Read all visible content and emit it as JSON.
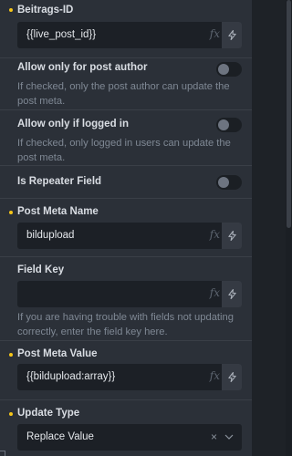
{
  "beitrags_id": {
    "label": "Beitrags-ID",
    "value": "{{live_post_id}}",
    "fx": "fx"
  },
  "allow_post_author": {
    "label": "Allow only for post author",
    "description": "If checked, only the post author can update the post meta.",
    "checked": false
  },
  "allow_logged_in": {
    "label": "Allow only if logged in",
    "description": "If checked, only logged in users can update the post meta.",
    "checked": false
  },
  "repeater_field": {
    "label": "Is Repeater Field",
    "checked": false
  },
  "post_meta_name": {
    "label": "Post Meta Name",
    "value": "bildupload",
    "fx": "fx"
  },
  "field_key": {
    "label": "Field Key",
    "value": "",
    "fx": "fx",
    "description": "If you are having trouble with fields not updating correctly, enter the field key here."
  },
  "post_meta_value": {
    "label": "Post Meta Value",
    "value": "{{bildupload:array}}",
    "fx": "fx"
  },
  "update_type": {
    "label": "Update Type",
    "value": "Replace Value",
    "clear_glyph": "×"
  },
  "colors": {
    "accent_dot": "#f5c518",
    "panel_bg": "#2b3038",
    "input_bg": "#1c2026"
  },
  "icons": [
    "bolt-icon",
    "fx-icon",
    "clear-icon",
    "chevron-down-icon"
  ]
}
